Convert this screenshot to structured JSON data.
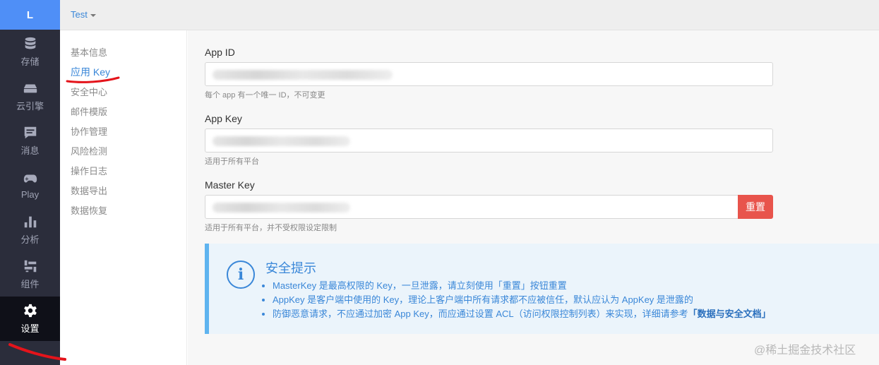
{
  "rail": {
    "logo": "L",
    "items": [
      {
        "label": "存储",
        "icon": "database-icon"
      },
      {
        "label": "云引擎",
        "icon": "server-icon"
      },
      {
        "label": "消息",
        "icon": "message-icon"
      },
      {
        "label": "Play",
        "icon": "gamepad-icon"
      },
      {
        "label": "分析",
        "icon": "bar-chart-icon"
      },
      {
        "label": "组件",
        "icon": "components-icon"
      },
      {
        "label": "设置",
        "icon": "gear-icon",
        "active": true
      }
    ]
  },
  "topbar": {
    "app_name": "Test"
  },
  "subnav": {
    "items": [
      "基本信息",
      "应用 Key",
      "安全中心",
      "邮件模版",
      "协作管理",
      "风险检测",
      "操作日志",
      "数据导出",
      "数据恢复"
    ],
    "active": "应用 Key"
  },
  "fields": {
    "app_id": {
      "label": "App ID",
      "help": "每个 app 有一个唯一 ID，不可变更"
    },
    "app_key": {
      "label": "App Key",
      "help": "适用于所有平台"
    },
    "master_key": {
      "label": "Master Key",
      "help": "适用于所有平台，并不受权限设定限制",
      "reset_label": "重置"
    }
  },
  "tips": {
    "icon": "info-icon",
    "title": "安全提示",
    "items": [
      "MasterKey 是最高权限的 Key，一旦泄露，请立刻使用「重置」按钮重置",
      "AppKey 是客户端中使用的 Key，理论上客户端中所有请求都不应被信任，默认应认为 AppKey 是泄露的"
    ],
    "item3_text": "防御恶意请求，不应通过加密 App Key，而应通过设置 ACL（访问权限控制列表）来实现，详细请参考",
    "item3_link": "「数据与安全文档」"
  },
  "watermark": "@稀土掘金技术社区",
  "colors": {
    "accent": "#3a87d8",
    "danger": "#e8544c",
    "rail": "#2b2d3b",
    "annotation": "#e4141b"
  }
}
